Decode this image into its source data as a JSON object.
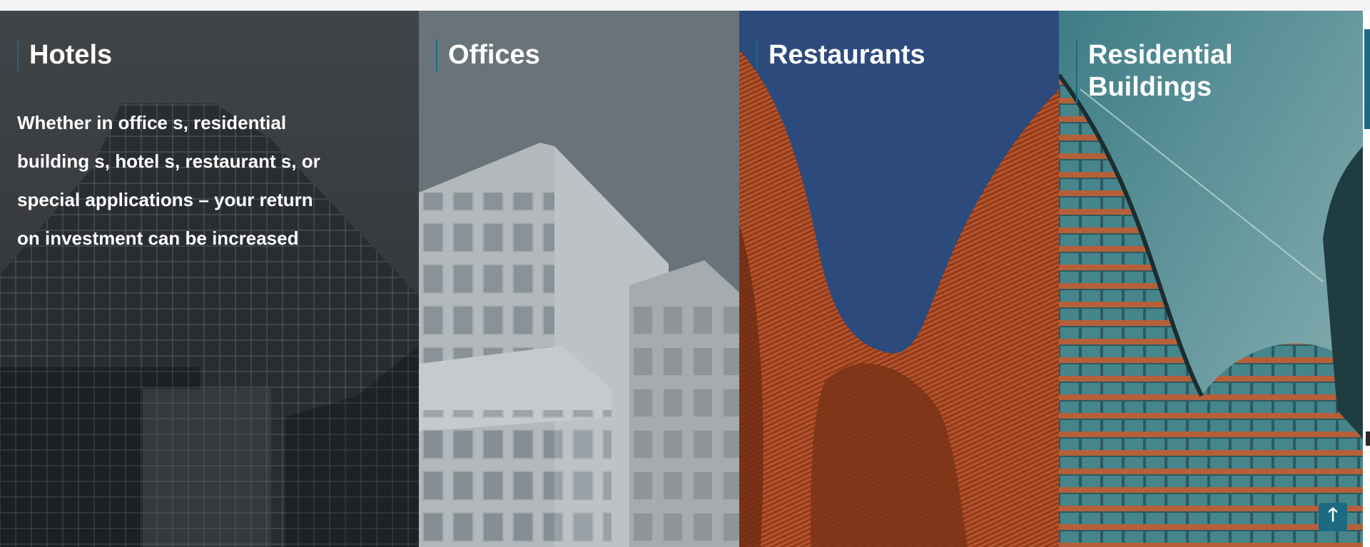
{
  "panels": [
    {
      "key": "hotels",
      "title": "Hotels",
      "description": "Whether in office s, residential building s, hotel s, restaurant s, or special applications – your return on investment can be increased"
    },
    {
      "key": "offices",
      "title": "Offices"
    },
    {
      "key": "restaurants",
      "title": "Restaurants"
    },
    {
      "key": "residential",
      "title": "Residential Buildings"
    }
  ],
  "scroll_top": {
    "icon": "arrow-up-icon",
    "glyph": "🡑"
  },
  "colors": {
    "accent": "#1c6b82",
    "restaurants_sky": "#2c4a7c",
    "offices_overlay": "#6b757d",
    "hotels_overlay": "#3d4144"
  }
}
